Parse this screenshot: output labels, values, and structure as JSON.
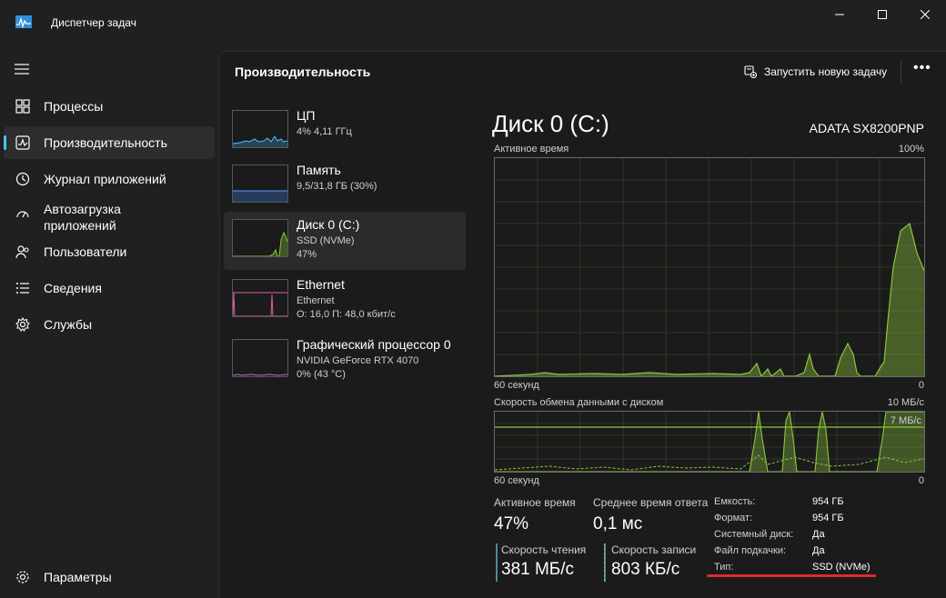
{
  "app": {
    "title": "Диспетчер задач"
  },
  "window_controls": {
    "minimize": "—",
    "maximize": "☐",
    "close": "✕"
  },
  "sidebar": {
    "items": [
      {
        "label": "Процессы",
        "icon": "processes-icon"
      },
      {
        "label": "Производительность",
        "icon": "performance-icon",
        "active": true
      },
      {
        "label": "Журнал приложений",
        "icon": "history-icon"
      },
      {
        "label": "Автозагрузка",
        "label2": "приложений",
        "icon": "startup-icon"
      },
      {
        "label": "Пользователи",
        "icon": "users-icon"
      },
      {
        "label": "Сведения",
        "icon": "details-icon"
      },
      {
        "label": "Службы",
        "icon": "services-icon"
      }
    ],
    "settings_label": "Параметры"
  },
  "header": {
    "title": "Производительность",
    "run_task_label": "Запустить новую задачу",
    "more": "•••"
  },
  "devices": [
    {
      "name": "ЦП",
      "line1": "4%  4,11 ГГц",
      "line2": "",
      "color": "#4cc2ff"
    },
    {
      "name": "Память",
      "line1": "9,5/31,8 ГБ (30%)",
      "line2": "",
      "color": "#3b7ae0"
    },
    {
      "name": "Диск 0 (C:)",
      "line1": "SSD (NVMe)",
      "line2": "47%",
      "color": "#8cc63f",
      "selected": true
    },
    {
      "name": "Ethernet",
      "line1": "Ethernet",
      "line2": "О: 16,0  П: 48,0 кбит/с",
      "color": "#e05ca8"
    },
    {
      "name": "Графический процессор 0",
      "line1": "NVIDIA GeForce RTX 4070",
      "line2": "0%  (43 °C)",
      "color": "#b469e0"
    }
  ],
  "detail": {
    "title": "Диск 0 (C:)",
    "model": "ADATA SX8200PNP",
    "graph1": {
      "label": "Активное время",
      "max_label": "100%",
      "x_label": "60 секунд",
      "min_label": "0"
    },
    "graph2": {
      "label": "Скорость обмена данными с диском",
      "max_label": "10 МБ/с",
      "ref_label": "7 МБ/с",
      "x_label": "60 секунд",
      "min_label": "0"
    },
    "stats": {
      "active_time_label": "Активное время",
      "active_time_value": "47%",
      "response_label": "Среднее время ответа",
      "response_value": "0,1 мс",
      "read_label": "Скорость чтения",
      "read_value": "381 МБ/с",
      "write_label": "Скорость записи",
      "write_value": "803 КБ/с"
    },
    "properties": [
      {
        "label": "Емкость:",
        "value": "954 ГБ"
      },
      {
        "label": "Формат:",
        "value": "954 ГБ"
      },
      {
        "label": "Системный диск:",
        "value": "Да"
      },
      {
        "label": "Файл подкачки:",
        "value": "Да"
      },
      {
        "label": "Тип:",
        "value": "SSD (NVMe)"
      }
    ]
  },
  "colors": {
    "disk": "#8cc63f",
    "accent": "#4cc2ff",
    "highlight": "#e02b2b"
  }
}
